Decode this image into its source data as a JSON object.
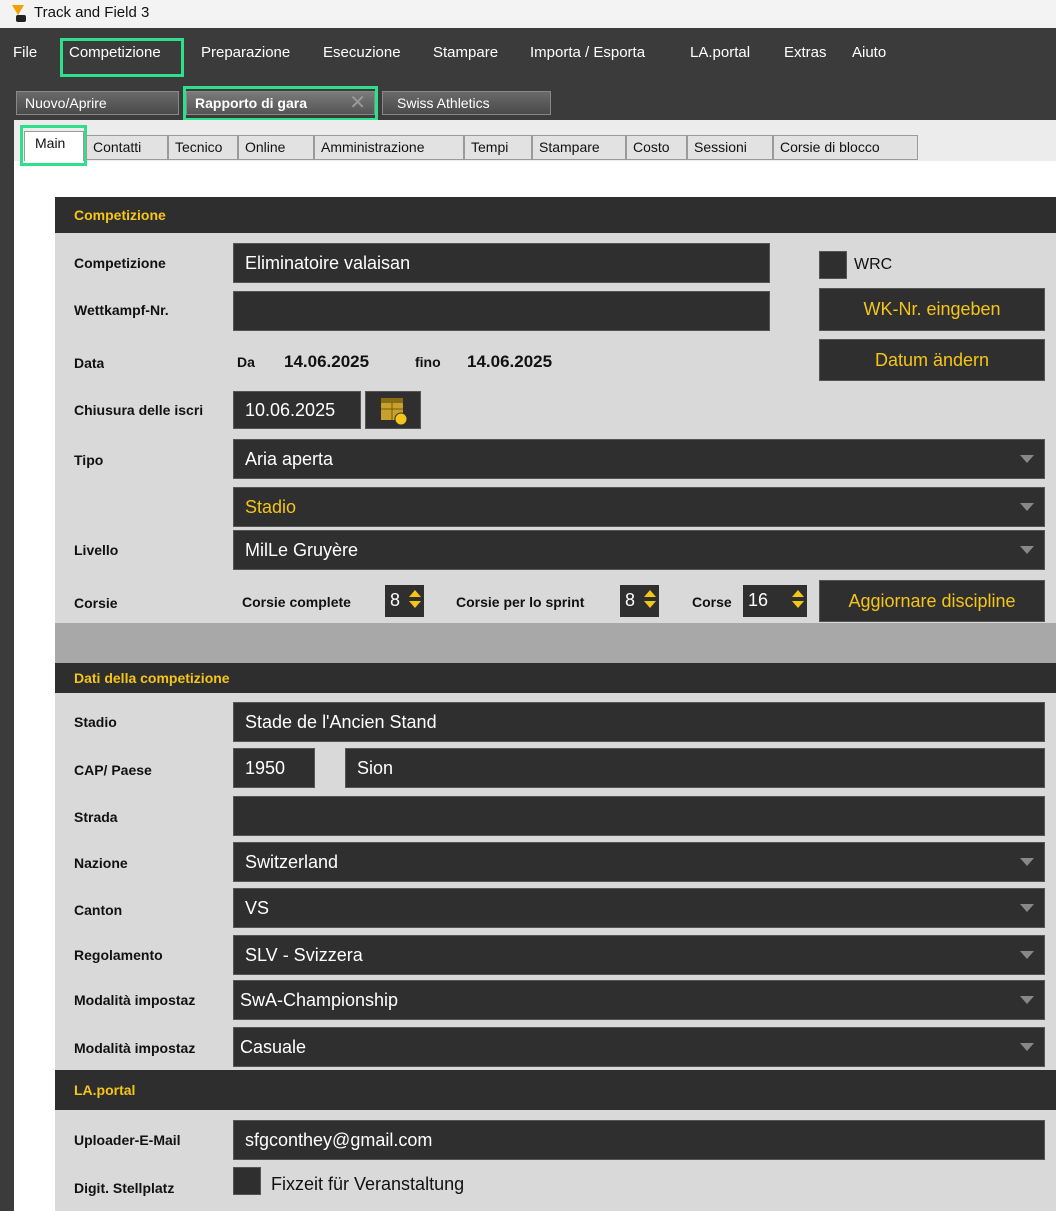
{
  "window": {
    "title": "Track and Field 3"
  },
  "menu": {
    "items": [
      "File",
      "Competizione",
      "Preparazione",
      "Esecuzione",
      "Stampare",
      "Importa / Esporta",
      "LA.portal",
      "Extras",
      "Aiuto"
    ]
  },
  "doc_tabs": {
    "new_open": "Nuovo/Aprire",
    "report": "Rapporto di gara",
    "swiss": "Swiss Athletics"
  },
  "sub_tabs": [
    "Main",
    "Contatti",
    "Tecnico",
    "Online",
    "Amministrazione",
    "Tempi",
    "Stampare",
    "Costo",
    "Sessioni",
    "Corsie di blocco"
  ],
  "competition": {
    "header": "Competizione",
    "name_label": "Competizione",
    "name_value": "Eliminatoire valaisan",
    "wrc_label": "WRC",
    "wk_label": "Wettkampf-Nr.",
    "wk_value": "",
    "wk_button": "WK-Nr. eingeben",
    "date_label": "Data",
    "date_from_label": "Da",
    "date_from": "14.06.2025",
    "date_to_label": "fino",
    "date_to": "14.06.2025",
    "date_button": "Datum ändern",
    "closing_label": "Chiusura delle iscri",
    "closing_value": "10.06.2025",
    "type_label": "Tipo",
    "type_value": "Aria aperta",
    "venue_type_value": "Stadio",
    "level_label": "Livello",
    "level_value": "MilLe Gruyère",
    "lanes_label": "Corsie",
    "full_lanes_label": "Corsie complete",
    "full_lanes_value": "8",
    "sprint_lanes_label": "Corsie per lo sprint",
    "sprint_lanes_value": "8",
    "tracks_label": "Corse",
    "tracks_value": "16",
    "update_button": "Aggiornare discipline"
  },
  "comp_data": {
    "header": "Dati della competizione",
    "stadium_label": "Stadio",
    "stadium_value": "Stade de l'Ancien Stand",
    "zip_label": "CAP/ Paese",
    "zip_value": "1950",
    "city_value": "Sion",
    "street_label": "Strada",
    "street_value": "",
    "nation_label": "Nazione",
    "nation_value": "Switzerland",
    "canton_label": "Canton",
    "canton_value": "VS",
    "rules_label": "Regolamento",
    "rules_value": "SLV - Svizzera",
    "mode1_label": "Modalità impostaz",
    "mode1_value": "SwA-Championship",
    "mode2_label": "Modalità impostaz",
    "mode2_value": "Casuale"
  },
  "laportal": {
    "header": "LA.portal",
    "email_label": "Uploader-E-Mail",
    "email_value": "sfgconthey@gmail.com",
    "digit_label": "Digit. Stellplatz",
    "fixtime_label": "Fixzeit für Veranstaltung"
  },
  "colors": {
    "accent": "#f5c518",
    "highlight": "#2fe08a",
    "field_bg": "#2f2f2f",
    "chrome": "#3b3b3b"
  }
}
